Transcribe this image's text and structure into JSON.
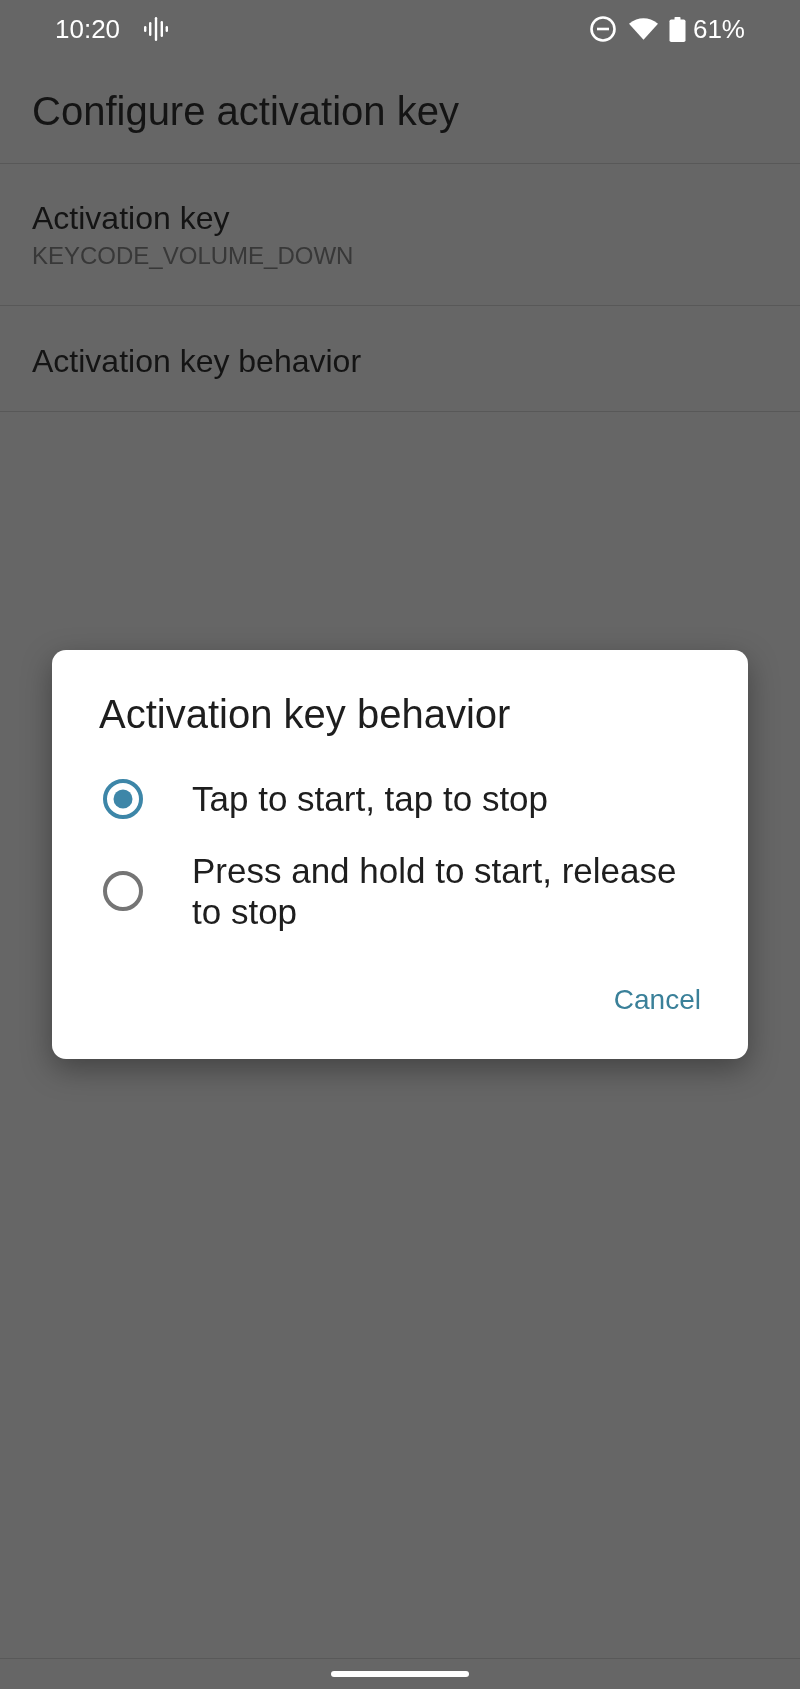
{
  "status_bar": {
    "time": "10:20",
    "battery": "61%"
  },
  "app_bar": {
    "title": "Configure activation key"
  },
  "preferences": [
    {
      "title": "Activation key",
      "summary": "KEYCODE_VOLUME_DOWN"
    },
    {
      "title": "Activation key behavior"
    }
  ],
  "dialog": {
    "title": "Activation key behavior",
    "options": [
      {
        "label": "Tap to start, tap to stop",
        "selected": true
      },
      {
        "label": "Press and hold to start, release to stop",
        "selected": false
      }
    ],
    "buttons": [
      "Cancel"
    ]
  }
}
